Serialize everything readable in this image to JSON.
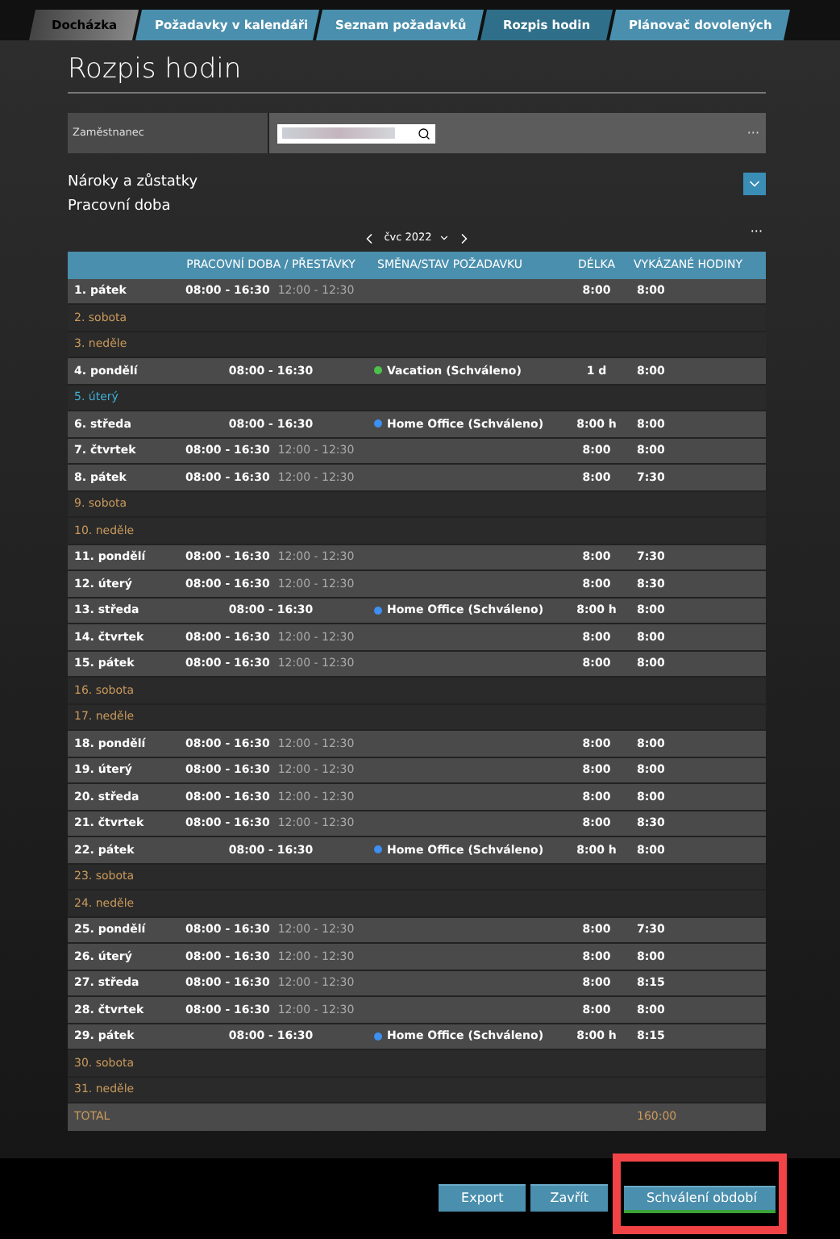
{
  "tabs": [
    {
      "label": "Docházka",
      "selected": false,
      "kind": "grey"
    },
    {
      "label": "Požadavky v kalendáři",
      "selected": false,
      "kind": "blue"
    },
    {
      "label": "Seznam požadavků",
      "selected": false,
      "kind": "blue"
    },
    {
      "label": "Rozpis hodin",
      "selected": true,
      "kind": "blue"
    },
    {
      "label": "Plánovač dovolených",
      "selected": false,
      "kind": "blue"
    }
  ],
  "page_title": "Rozpis hodin",
  "employee": {
    "label": "Zaměstnanec",
    "more": "···"
  },
  "sections": [
    {
      "label": "Nároky a zůstatky",
      "expanded": false
    },
    {
      "label": "Pracovní doba"
    }
  ],
  "month_nav": {
    "month": "čvc 2022",
    "more": "···"
  },
  "table": {
    "columns": [
      "PRACOVNÍ DOBA / PŘESTÁVKY",
      "SMĚNA/STAV POŽADAVKU",
      "DÉLKA",
      "VYKÁZANÉ HODINY"
    ],
    "rows": [
      {
        "day": "1. pátek",
        "kind": "workday",
        "hours": "08:00 - 16:30",
        "break": "12:00 - 12:30",
        "length": "8:00",
        "reported": "8:00"
      },
      {
        "day": "2. sobota",
        "kind": "weekend"
      },
      {
        "day": "3. neděle",
        "kind": "weekend"
      },
      {
        "day": "4. pondělí",
        "kind": "request",
        "hours": "08:00 - 16:30",
        "shift": "Vacation (Schváleno)",
        "color": "#4cc24c",
        "length": "1 d",
        "reported": "8:00"
      },
      {
        "day": "5. úterý",
        "kind": "holiday"
      },
      {
        "day": "6. středa",
        "kind": "request",
        "hours": "08:00 - 16:30",
        "shift": "Home Office (Schváleno)",
        "color": "#3d8ff0",
        "length": "8:00 h",
        "reported": "8:00"
      },
      {
        "day": "7. čtvrtek",
        "kind": "workday",
        "hours": "08:00 - 16:30",
        "break": "12:00 - 12:30",
        "length": "8:00",
        "reported": "8:00"
      },
      {
        "day": "8. pátek",
        "kind": "workday",
        "hours": "08:00 - 16:30",
        "break": "12:00 - 12:30",
        "length": "8:00",
        "reported": "7:30"
      },
      {
        "day": "9. sobota",
        "kind": "weekend"
      },
      {
        "day": "10. neděle",
        "kind": "weekend"
      },
      {
        "day": "11. pondělí",
        "kind": "workday",
        "hours": "08:00 - 16:30",
        "break": "12:00 - 12:30",
        "length": "8:00",
        "reported": "7:30"
      },
      {
        "day": "12. úterý",
        "kind": "workday",
        "hours": "08:00 - 16:30",
        "break": "12:00 - 12:30",
        "length": "8:00",
        "reported": "8:30"
      },
      {
        "day": "13. středa",
        "kind": "request",
        "hours": "08:00 - 16:30",
        "shift": "Home Office (Schváleno)",
        "color": "#3d8ff0",
        "length": "8:00 h",
        "reported": "8:00"
      },
      {
        "day": "14. čtvrtek",
        "kind": "workday",
        "hours": "08:00 - 16:30",
        "break": "12:00 - 12:30",
        "length": "8:00",
        "reported": "8:00"
      },
      {
        "day": "15. pátek",
        "kind": "workday",
        "hours": "08:00 - 16:30",
        "break": "12:00 - 12:30",
        "length": "8:00",
        "reported": "8:00"
      },
      {
        "day": "16. sobota",
        "kind": "weekend"
      },
      {
        "day": "17. neděle",
        "kind": "weekend"
      },
      {
        "day": "18. pondělí",
        "kind": "workday",
        "hours": "08:00 - 16:30",
        "break": "12:00 - 12:30",
        "length": "8:00",
        "reported": "8:00"
      },
      {
        "day": "19. úterý",
        "kind": "workday",
        "hours": "08:00 - 16:30",
        "break": "12:00 - 12:30",
        "length": "8:00",
        "reported": "8:00"
      },
      {
        "day": "20. středa",
        "kind": "workday",
        "hours": "08:00 - 16:30",
        "break": "12:00 - 12:30",
        "length": "8:00",
        "reported": "8:00"
      },
      {
        "day": "21. čtvrtek",
        "kind": "workday",
        "hours": "08:00 - 16:30",
        "break": "12:00 - 12:30",
        "length": "8:00",
        "reported": "8:30"
      },
      {
        "day": "22. pátek",
        "kind": "request",
        "hours": "08:00 - 16:30",
        "shift": "Home Office (Schváleno)",
        "color": "#3d8ff0",
        "length": "8:00 h",
        "reported": "8:00"
      },
      {
        "day": "23. sobota",
        "kind": "weekend"
      },
      {
        "day": "24. neděle",
        "kind": "weekend"
      },
      {
        "day": "25. pondělí",
        "kind": "workday",
        "hours": "08:00 - 16:30",
        "break": "12:00 - 12:30",
        "length": "8:00",
        "reported": "7:30"
      },
      {
        "day": "26. úterý",
        "kind": "workday",
        "hours": "08:00 - 16:30",
        "break": "12:00 - 12:30",
        "length": "8:00",
        "reported": "8:00"
      },
      {
        "day": "27. středa",
        "kind": "workday",
        "hours": "08:00 - 16:30",
        "break": "12:00 - 12:30",
        "length": "8:00",
        "reported": "8:15"
      },
      {
        "day": "28. čtvrtek",
        "kind": "workday",
        "hours": "08:00 - 16:30",
        "break": "12:00 - 12:30",
        "length": "8:00",
        "reported": "8:00"
      },
      {
        "day": "29. pátek",
        "kind": "request",
        "hours": "08:00 - 16:30",
        "shift": "Home Office (Schváleno)",
        "color": "#3d8ff0",
        "length": "8:00 h",
        "reported": "8:15"
      },
      {
        "day": "30. sobota",
        "kind": "weekend"
      },
      {
        "day": "31. neděle",
        "kind": "weekend"
      }
    ],
    "total": {
      "label": "TOTAL",
      "reported": "160:00"
    }
  },
  "buttons": [
    {
      "label": "Export",
      "highlighted": false
    },
    {
      "label": "Zavřít",
      "highlighted": false
    },
    {
      "label": "Schválení období",
      "highlighted": true
    }
  ]
}
